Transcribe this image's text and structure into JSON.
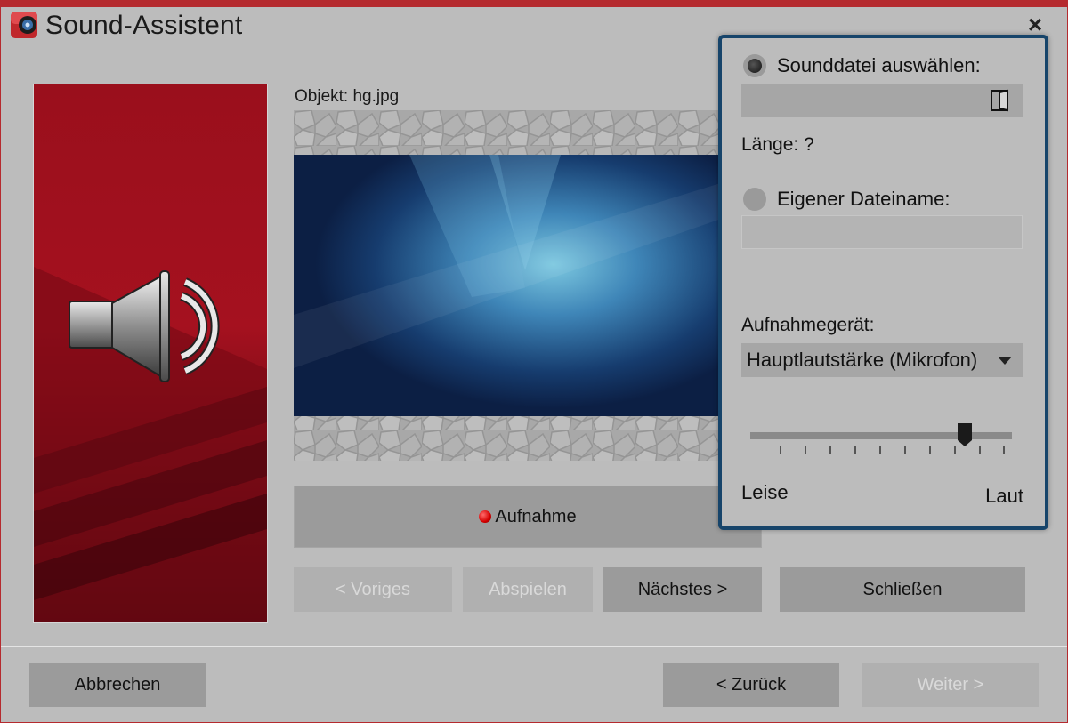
{
  "window": {
    "title": "Sound-Assistent",
    "close_label": "×",
    "accent_color": "#b52a2e"
  },
  "main": {
    "object_label": "Objekt: hg.jpg",
    "record_button": "Aufnahme",
    "buttons": {
      "previous": "< Voriges",
      "play": "Abspielen",
      "next": "Nächstes >",
      "close": "Schließen"
    }
  },
  "panel": {
    "option_soundfile": "Sounddatei auswählen:",
    "soundfile_value": "",
    "length_label": "Länge: ?",
    "option_own_name": "Eigener Dateiname:",
    "own_name_value": "",
    "device_label": "Aufnahmegerät:",
    "device_value": "Hauptlautstärke (Mikrofon)",
    "volume_min_label": "Leise",
    "volume_max_label": "Laut",
    "volume_level_percent": 82,
    "border_color": "#16446a"
  },
  "footer": {
    "cancel": "Abbrechen",
    "back": "< Zurück",
    "next": "Weiter >"
  },
  "icons": [
    "app-icon",
    "close-icon",
    "speaker-icon",
    "folder-icon",
    "record-dot-icon",
    "chevron-down-icon"
  ]
}
